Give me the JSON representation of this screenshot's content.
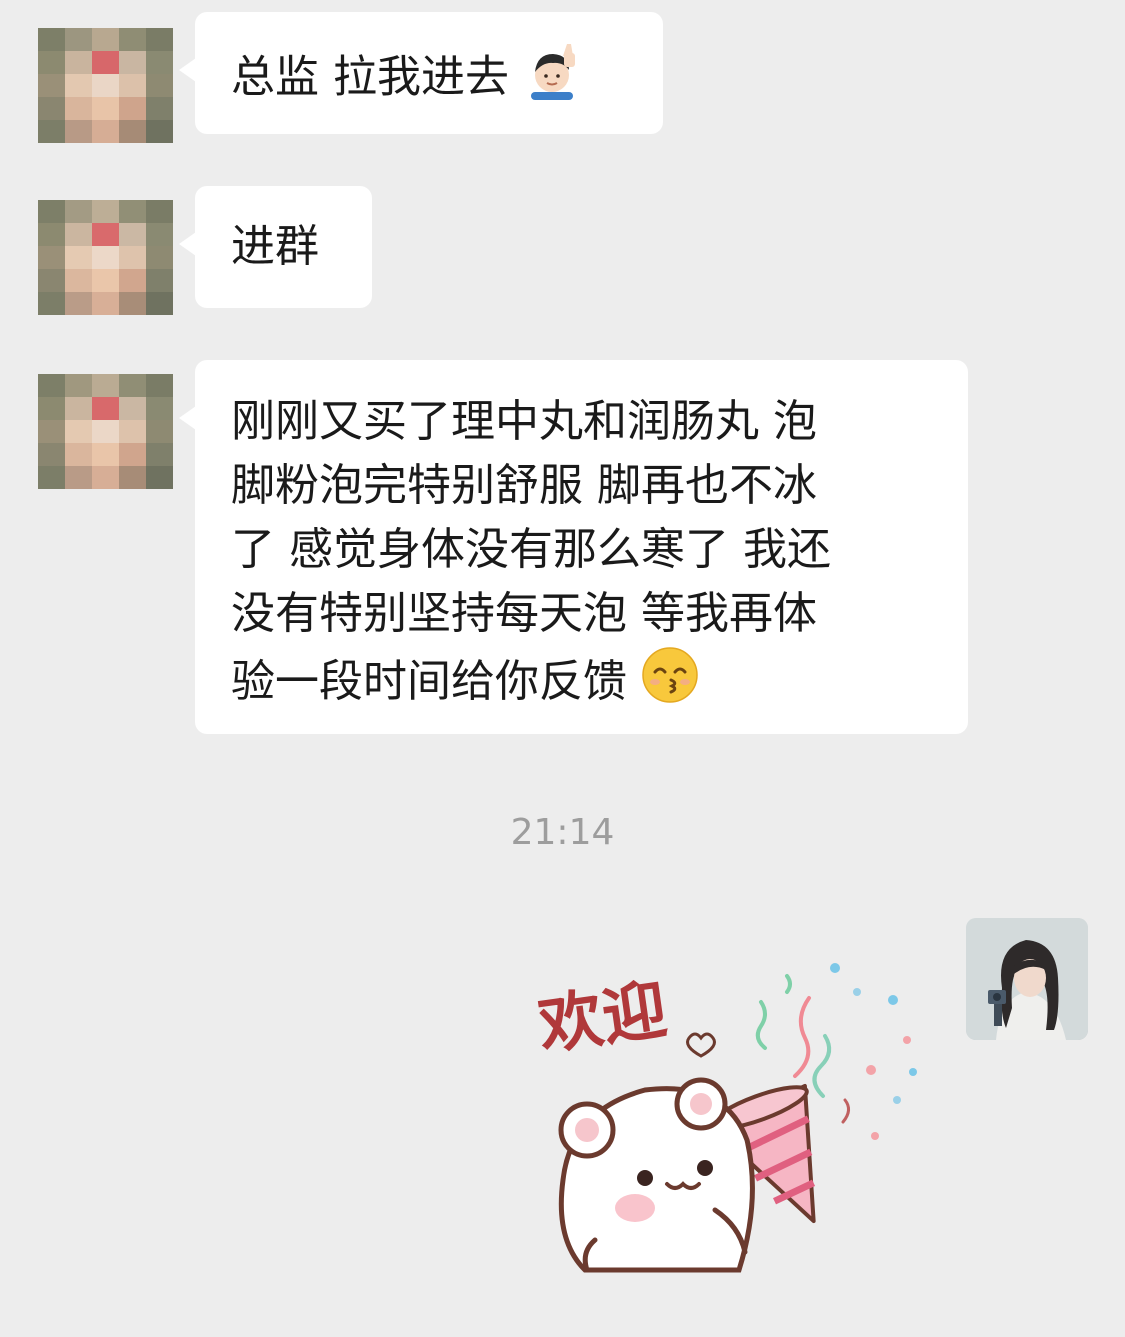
{
  "messages": [
    {
      "sender": "other",
      "text": "总监 拉我进去",
      "emoji": "raising-hand-man-emoji"
    },
    {
      "sender": "other",
      "text": "进群"
    },
    {
      "sender": "other",
      "lines": [
        "刚刚又买了理中丸和润肠丸 泡",
        "脚粉泡完特别舒服 脚再也不冰",
        "了 感觉身体没有那么寒了 我还",
        "没有特别坚持每天泡 等我再体",
        "验一段时间给你反馈"
      ],
      "emoji": "kissing-face-emoji"
    }
  ],
  "timestamp": "21:14",
  "sticker": {
    "text": "欢迎",
    "icon": "bear-party-popper-sticker"
  },
  "colors": {
    "background": "#ededed",
    "bubble": "#ffffff",
    "text": "#1a1a1a",
    "timestamp": "#9d9d9d"
  }
}
